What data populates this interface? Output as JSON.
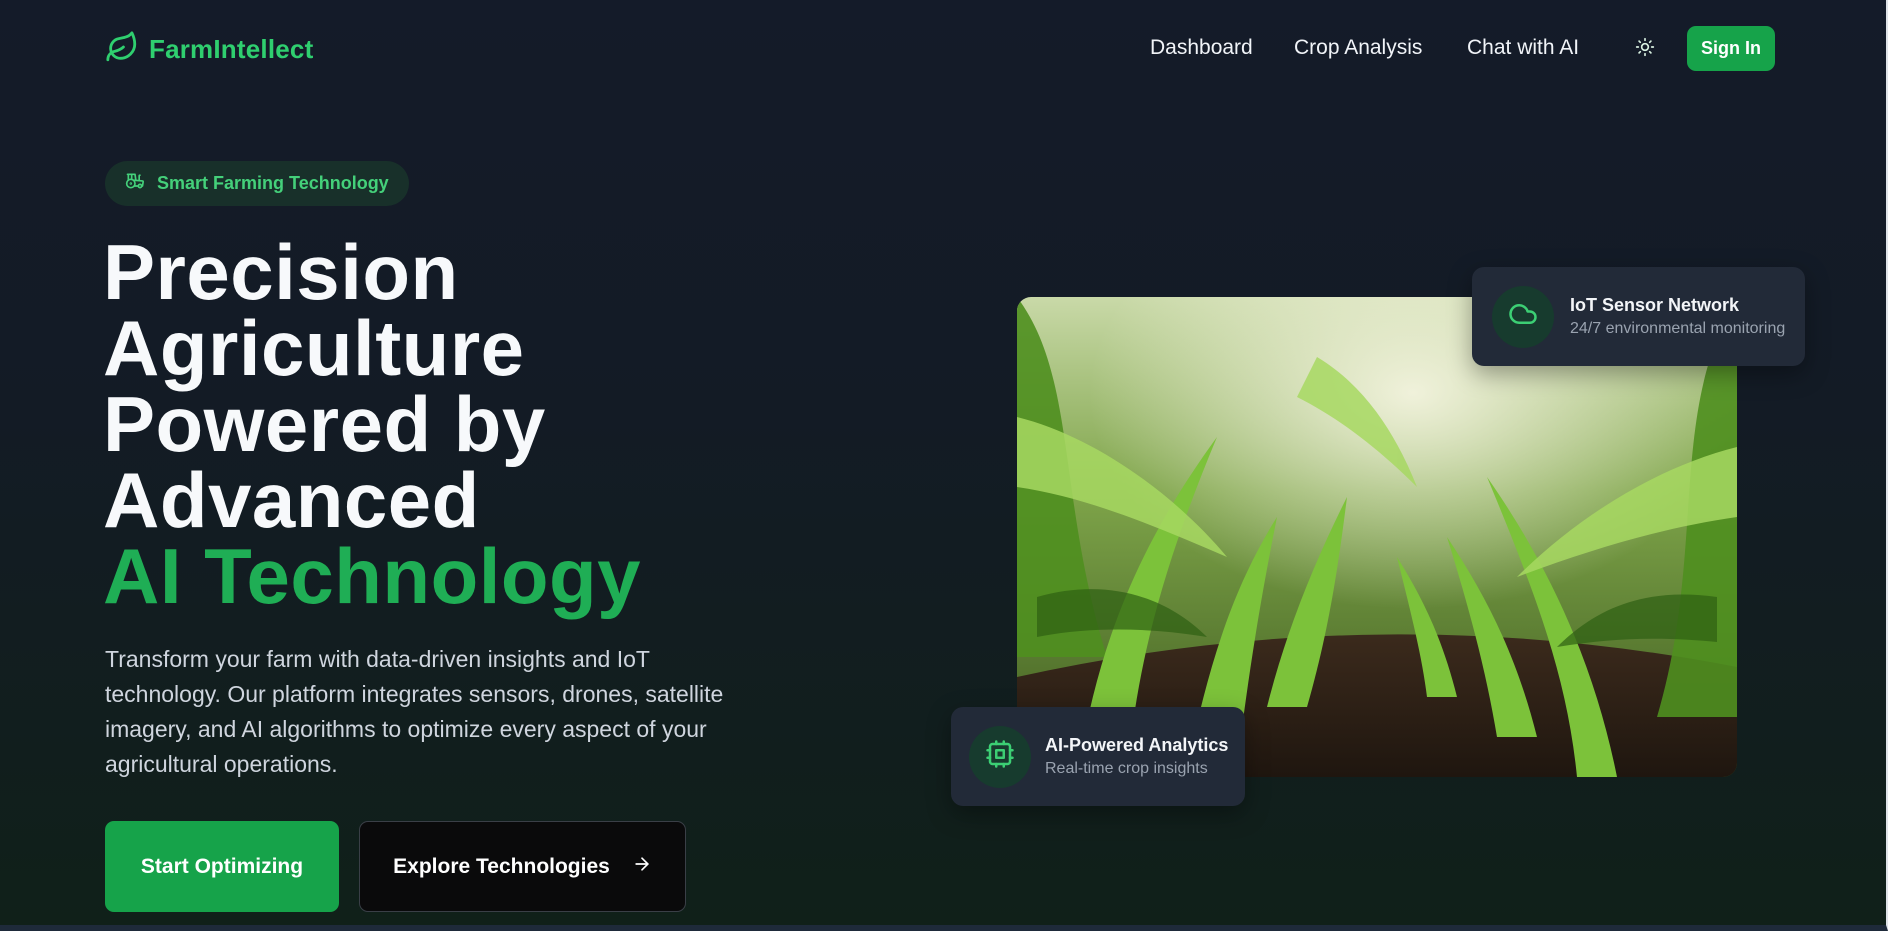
{
  "nav": {
    "brand": "FarmIntellect",
    "links": [
      "Dashboard",
      "Crop Analysis",
      "Chat with AI"
    ],
    "signin_label": "Sign In"
  },
  "hero": {
    "badge": "Smart Farming Technology",
    "title_lines": [
      "Precision",
      "Agriculture",
      "Powered by",
      "Advanced"
    ],
    "title_accent": "AI Technology",
    "description": "Transform your farm with data-driven insights and IoT technology. Our platform integrates sensors, drones, satellite imagery, and AI algorithms to optimize every aspect of your agricultural operations.",
    "primary_cta": "Start Optimizing",
    "secondary_cta": "Explore Technologies"
  },
  "cards": {
    "iot": {
      "title": "IoT Sensor Network",
      "subtitle": "24/7 environmental monitoring"
    },
    "ai": {
      "title": "AI-Powered Analytics",
      "subtitle": "Real-time crop insights"
    }
  },
  "colors": {
    "accent": "#16a34a",
    "accent_text": "#2fcf6f",
    "background": "#141b29",
    "card": "#222a38"
  },
  "icons": {
    "brand": "leaf-icon",
    "theme": "sun-icon",
    "badge": "tractor-icon",
    "secondary_cta": "arrow-right-icon",
    "iot_card": "cloud-icon",
    "ai_card": "cpu-icon"
  }
}
